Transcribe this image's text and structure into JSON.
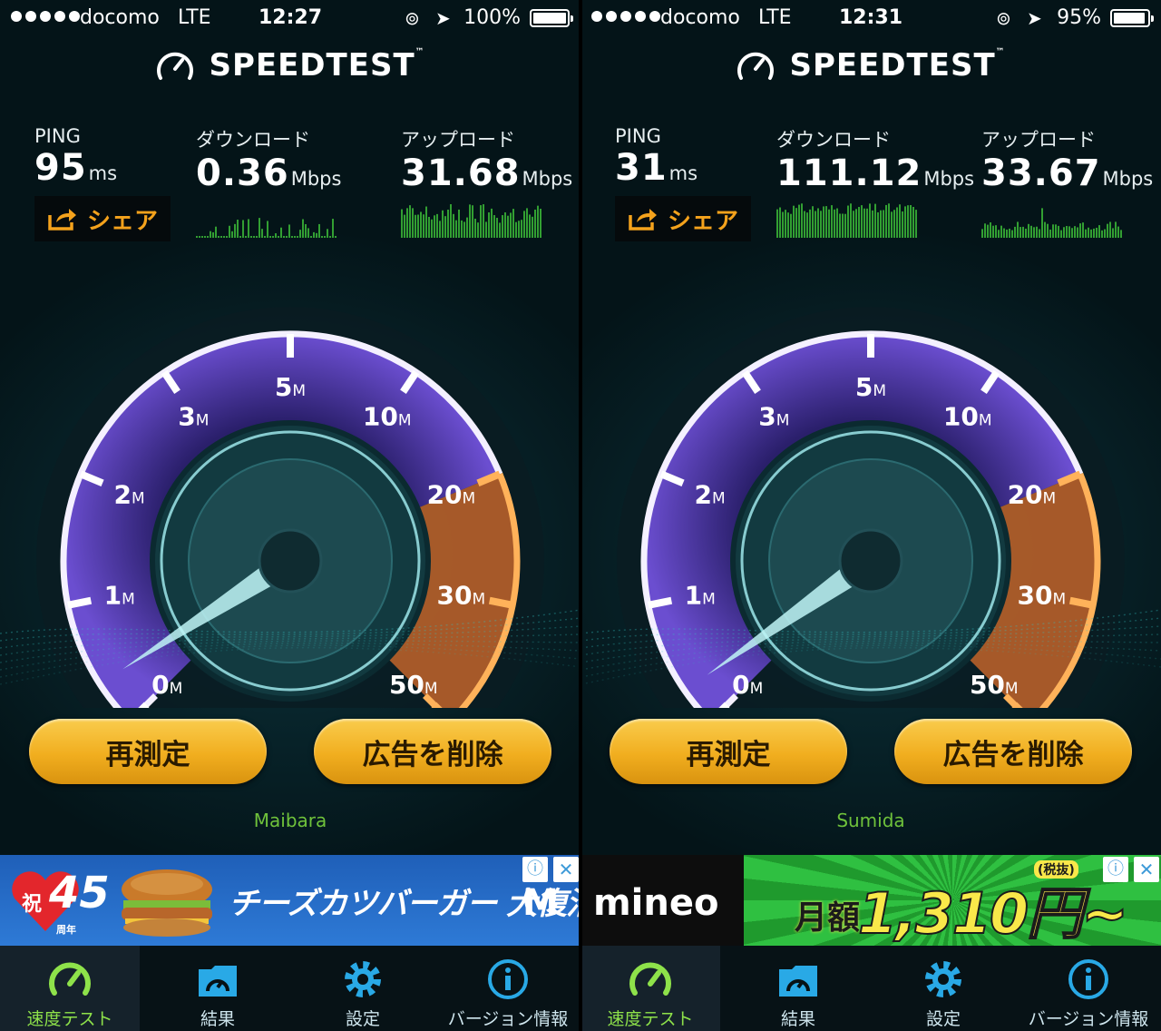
{
  "screens": [
    {
      "status": {
        "carrier": "docomo",
        "network": "LTE",
        "time": "12:27",
        "battery": "100%",
        "battery_level": 1.0
      },
      "app": {
        "title": "SPEEDTEST",
        "tm": "™"
      },
      "stats": {
        "ping_label": "PING",
        "ping_value": "95",
        "ping_unit": "ms",
        "download_label": "ダウンロード",
        "download_value": "0.36",
        "download_unit": "Mbps",
        "upload_label": "アップロード",
        "upload_value": "31.68",
        "upload_unit": "Mbps",
        "share_label": "シェア"
      },
      "gauge": {
        "ticks": [
          "0",
          "1",
          "2",
          "3",
          "5",
          "10",
          "20",
          "30",
          "50"
        ],
        "unit": "M",
        "needle_value_mbps": 0.36
      },
      "buttons": {
        "retest": "再測定",
        "remove_ads": "広告を削除"
      },
      "server": "Maibara",
      "ad": {
        "type": "mcdonalds",
        "anniversary": "45",
        "celebrate": "祝",
        "years": "周年",
        "headline": "チーズカツバーガー 大復活",
        "logo": "M"
      },
      "tabs": [
        "速度テスト",
        "結果",
        "設定",
        "バージョン情報"
      ]
    },
    {
      "status": {
        "carrier": "docomo",
        "network": "LTE",
        "time": "12:31",
        "battery": "95%",
        "battery_level": 0.95
      },
      "app": {
        "title": "SPEEDTEST",
        "tm": "™"
      },
      "stats": {
        "ping_label": "PING",
        "ping_value": "31",
        "ping_unit": "ms",
        "download_label": "ダウンロード",
        "download_value": "111.12",
        "download_unit": "Mbps",
        "upload_label": "アップロード",
        "upload_value": "33.67",
        "upload_unit": "Mbps",
        "share_label": "シェア"
      },
      "gauge": {
        "ticks": [
          "0",
          "1",
          "2",
          "3",
          "5",
          "10",
          "20",
          "30",
          "50"
        ],
        "unit": "M",
        "needle_value_mbps": 0.3
      },
      "buttons": {
        "retest": "再測定",
        "remove_ads": "広告を削除"
      },
      "server": "Sumida",
      "ad": {
        "type": "mineo",
        "brand": "mineo",
        "price_label": "月額",
        "price": "1,310円~",
        "tax": "(税抜)"
      },
      "tabs": [
        "速度テスト",
        "結果",
        "設定",
        "バージョン情報"
      ]
    }
  ],
  "colors": {
    "accent_green": "#8ee24a",
    "button_gold": "#f1ae1f",
    "gauge_purple": "#5a3fb0",
    "gauge_orange": "#e07a24",
    "server_green": "#6fc23b"
  },
  "icons": [
    "lock-rotation-icon",
    "location-arrow-icon",
    "battery-icon",
    "speedometer-logo-icon",
    "share-icon",
    "ad-info-icon",
    "ad-close-icon",
    "speed-test-tab-icon",
    "results-folder-icon",
    "settings-gear-icon",
    "info-icon"
  ]
}
